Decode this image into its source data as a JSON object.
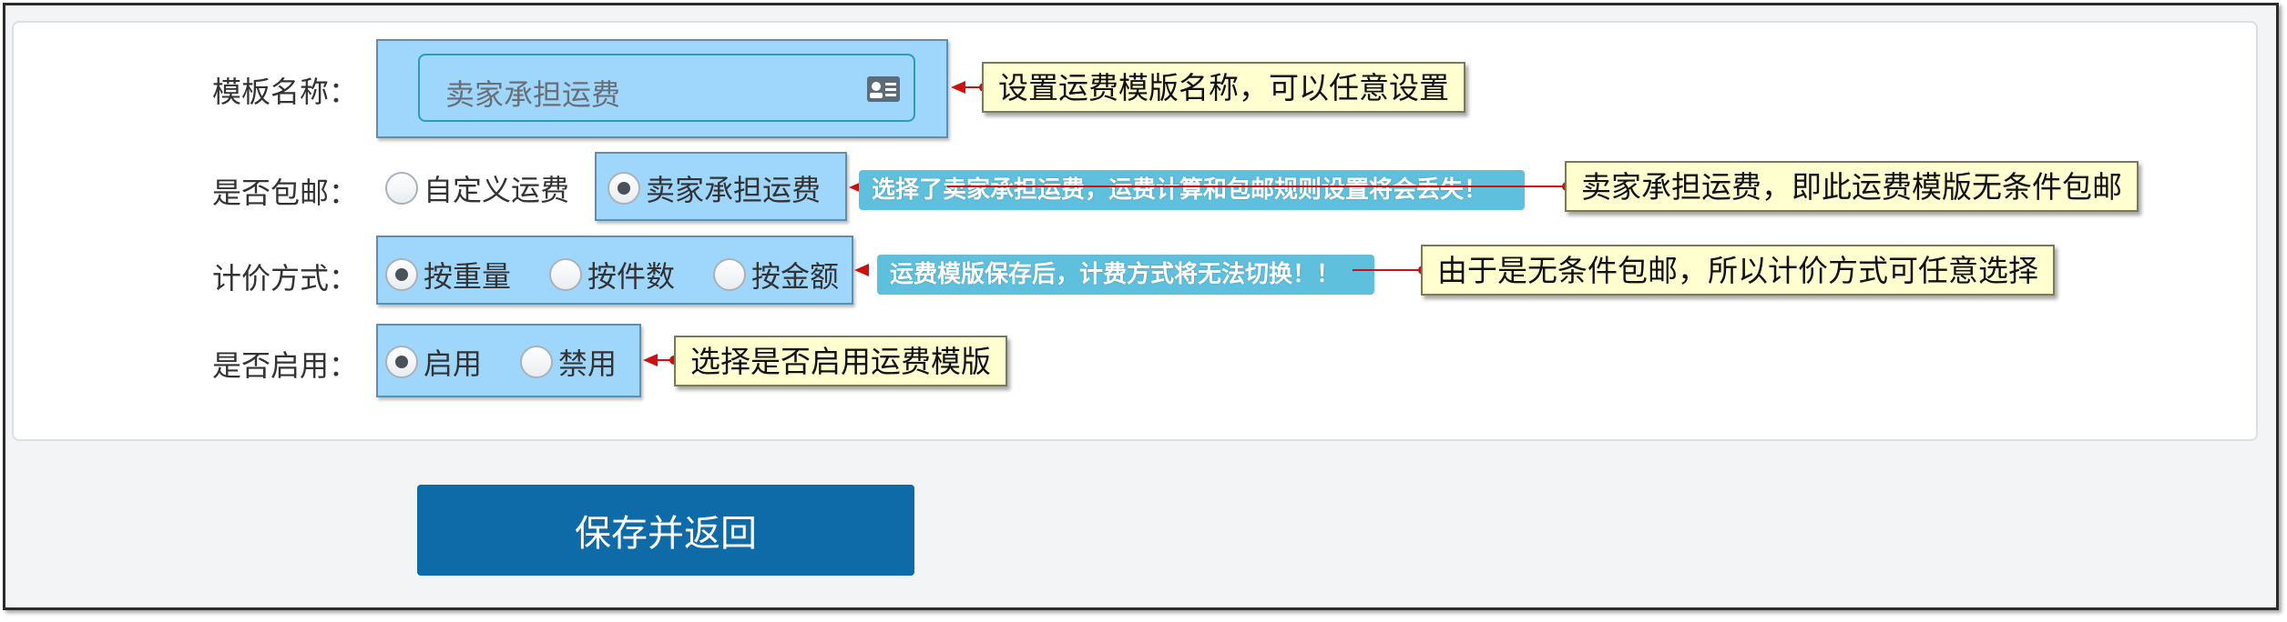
{
  "form": {
    "template_name": {
      "label": "模板名称：",
      "value": "卖家承担运费",
      "icon": "contact-card-icon"
    },
    "free_shipping": {
      "label": "是否包邮：",
      "options": [
        "自定义运费",
        "卖家承担运费"
      ],
      "selected": "卖家承担运费"
    },
    "pricing_method": {
      "label": "计价方式：",
      "options": [
        "按重量",
        "按件数",
        "按金额"
      ],
      "selected": "按重量"
    },
    "enabled": {
      "label": "是否启用：",
      "options": [
        "启用",
        "禁用"
      ],
      "selected": "启用"
    }
  },
  "tags": {
    "free_shipping_warning": "选择了卖家承担运费，运费计算和包邮规则设置将会丢失！",
    "pricing_warning": "运费模版保存后，计费方式将无法切换！！"
  },
  "notes": {
    "template_name": "设置运费模版名称，可以任意设置",
    "free_shipping": "卖家承担运费，即此运费模版无条件包邮",
    "pricing_method": "由于是无条件包邮，所以计价方式可任意选择",
    "enabled": "选择是否启用运费模版"
  },
  "actions": {
    "save_label": "保存并返回"
  },
  "colors": {
    "highlight": "#9ed7fb",
    "tag_bg": "#5fc0de",
    "note_bg": "#ffffd0",
    "arrow": "#cc1111",
    "save_button": "#0f6aa8"
  }
}
